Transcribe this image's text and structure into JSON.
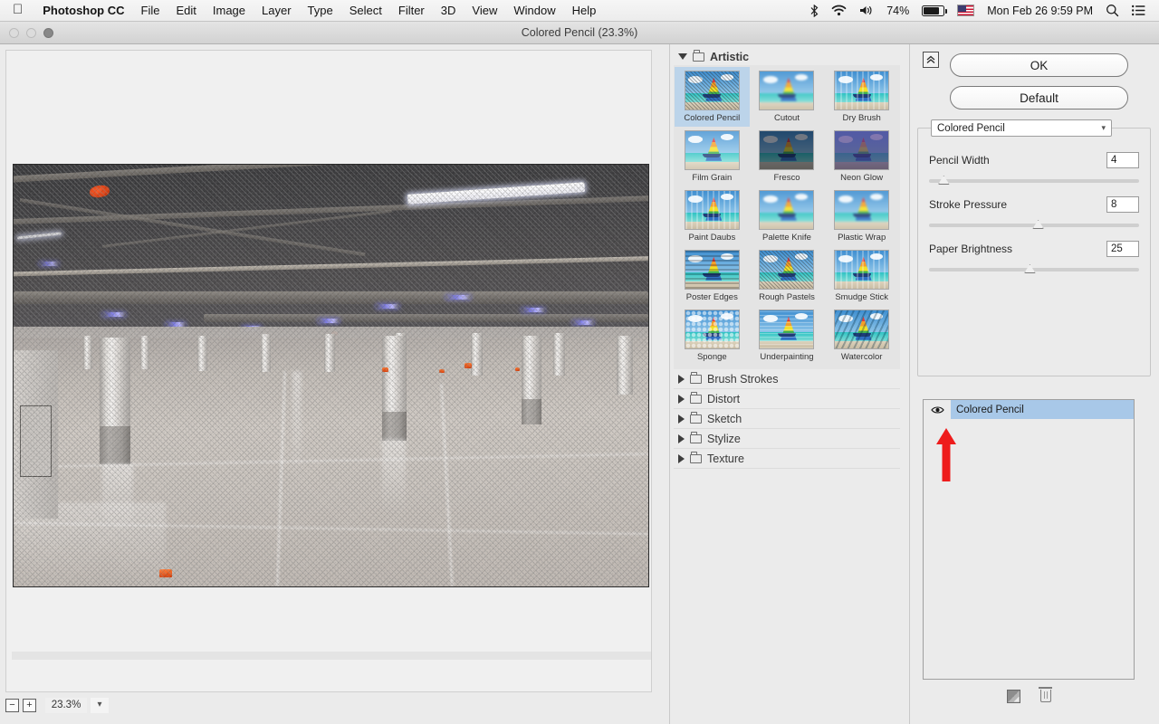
{
  "menubar": {
    "apple_icon": "apple-logo-icon",
    "app_name": "Photoshop CC",
    "items": [
      "File",
      "Edit",
      "Image",
      "Layer",
      "Type",
      "Select",
      "Filter",
      "3D",
      "View",
      "Window",
      "Help"
    ],
    "status": {
      "bluetooth_icon": "bluetooth-icon",
      "wifi_icon": "wifi-icon",
      "volume_icon": "volume-icon",
      "battery_percent": "74%",
      "battery_icon": "battery-icon",
      "flag_icon": "us-flag-icon",
      "datetime": "Mon Feb 26  9:59 PM",
      "search_icon": "search-icon",
      "list_icon": "notification-center-icon"
    }
  },
  "window": {
    "title": "Colored Pencil (23.3%)",
    "traffic_lights": [
      "close",
      "minimize",
      "zoom"
    ]
  },
  "preview": {
    "zoom_out_label": "−",
    "zoom_in_label": "+",
    "zoom_value": "23.3%",
    "zoom_caret": "chevron-down-icon"
  },
  "browser": {
    "expanded_category": {
      "name": "Artistic",
      "triangle": "triangle-down-icon",
      "folder_icon": "folder-icon",
      "filters": [
        {
          "label": "Colored Pencil",
          "selected": true,
          "fx": "hatchfx"
        },
        {
          "label": "Cutout",
          "selected": false,
          "fx": "blurfx"
        },
        {
          "label": "Dry Brush",
          "selected": false,
          "fx": "smearfx"
        },
        {
          "label": "Film Grain",
          "selected": false,
          "fx": "grainfx"
        },
        {
          "label": "Fresco",
          "selected": false,
          "fx": "darkfx"
        },
        {
          "label": "Neon Glow",
          "selected": false,
          "fx": "neonfx"
        },
        {
          "label": "Paint Daubs",
          "selected": false,
          "fx": "smearfx"
        },
        {
          "label": "Palette Knife",
          "selected": false,
          "fx": "blurfx"
        },
        {
          "label": "Plastic Wrap",
          "selected": false,
          "fx": "blurfx"
        },
        {
          "label": "Poster Edges",
          "selected": false,
          "fx": "postfx"
        },
        {
          "label": "Rough Pastels",
          "selected": false,
          "fx": "hatchfx"
        },
        {
          "label": "Smudge Stick",
          "selected": false,
          "fx": "smearfx"
        },
        {
          "label": "Sponge",
          "selected": false,
          "fx": "spongefx"
        },
        {
          "label": "Underpainting",
          "selected": false,
          "fx": "underfx"
        },
        {
          "label": "Watercolor",
          "selected": false,
          "fx": "waterfx"
        }
      ]
    },
    "collapsed_categories": [
      {
        "label": "Brush Strokes",
        "triangle": "triangle-right-icon",
        "folder_icon": "folder-icon"
      },
      {
        "label": "Distort",
        "triangle": "triangle-right-icon",
        "folder_icon": "folder-icon"
      },
      {
        "label": "Sketch",
        "triangle": "triangle-right-icon",
        "folder_icon": "folder-icon"
      },
      {
        "label": "Stylize",
        "triangle": "triangle-right-icon",
        "folder_icon": "folder-icon"
      },
      {
        "label": "Texture",
        "triangle": "triangle-right-icon",
        "folder_icon": "folder-icon"
      }
    ]
  },
  "controls": {
    "collapse_icon": "collapse-panel-icon",
    "ok_label": "OK",
    "default_label": "Default",
    "filter_select": {
      "value": "Colored Pencil",
      "caret": "chevron-down-icon"
    },
    "params": [
      {
        "label": "Pencil Width",
        "value": "4",
        "percent": 7
      },
      {
        "label": "Stroke Pressure",
        "value": "8",
        "percent": 52
      },
      {
        "label": "Paper Brightness",
        "value": "25",
        "percent": 48
      }
    ]
  },
  "layer_panel": {
    "eye_icon": "visibility-eye-icon",
    "layers": [
      {
        "name": "Colored Pencil",
        "visible": true,
        "selected": true
      }
    ],
    "annotation": {
      "type": "red-arrow",
      "color": "#ee1c1c",
      "points_at": "visibility-eye-icon"
    },
    "footer": {
      "new_effect_layer_icon": "new-effect-layer-icon",
      "delete_layer_icon": "trash-icon"
    }
  },
  "colors": {
    "selection_blue": "#a8c8e8",
    "thumb_selection": "#bcd4ea",
    "panel_bg": "#ebebeb",
    "annotation_red": "#ee1c1c"
  }
}
